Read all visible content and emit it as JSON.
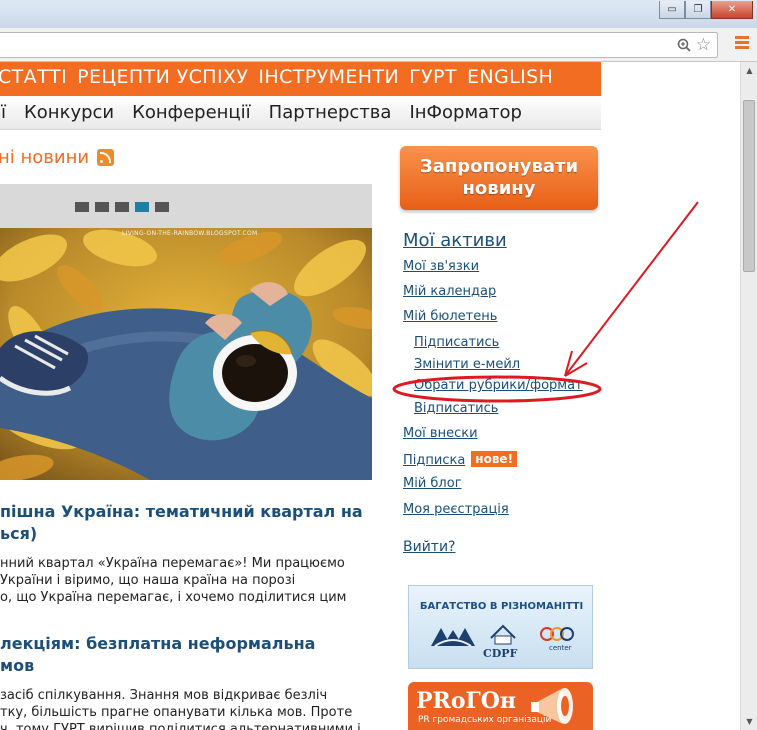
{
  "window": {
    "buttons": [
      "▭",
      "❐",
      "✕"
    ]
  },
  "nav_primary": [
    "СТАТТІ",
    "РЕЦЕПТИ УСПІХУ",
    "ІНСТРУМЕНТИ",
    "ГУРТ",
    "ENGLISH"
  ],
  "nav_secondary": [
    "ії",
    "Конкурси",
    "Конференції",
    "Партнерства",
    "ІнФорматор"
  ],
  "news": {
    "title": "ні новини"
  },
  "slider": {
    "total": 5,
    "active_index": 4
  },
  "photo": {
    "watermark": "LIVING-ON-THE-RAINBOW.BLOGSPOT.COM"
  },
  "articles": [
    {
      "title_lines": [
        "пішна Україна: тематичний квартал на",
        "ься)"
      ],
      "text_lines": [
        "нний квартал «Україна перемагає»! Ми працюємо",
        "України і віримо, що наша країна на порозі",
        "о, що Україна перемагає, і хочемо поділитися цим"
      ]
    },
    {
      "title_lines": [
        "лекціям: безплатна неформальна",
        "мов"
      ],
      "text_lines": [
        "засіб спілкування. Знання мов відкриває безліч",
        "тку, більшість прагне опанувати кілька мов. Проте",
        "ч, тому ГУРТ вирішив поділитися альтернативними і"
      ]
    }
  ],
  "sidebar": {
    "suggest_button": "Запропонувати новину",
    "assets_heading": "Мої активи",
    "links": {
      "connections": "Мої зв'язки",
      "calendar": "Мій календар",
      "bulletin": "Мій бюлетень",
      "subscribe": "Підписатись",
      "change_email": "Змінити е-мейл",
      "choose_rubrics": "Обрати рубрики/формат",
      "unsubscribe": "Відписатись",
      "contributions": "Мої внески",
      "subscription": "Підписка",
      "blog": "Мій блог",
      "registration": "Моя реєстрація"
    },
    "new_badge": "нове!",
    "logout": "Вийти?"
  },
  "banners": {
    "diversity": {
      "header": "БАГАТСТВО В РІЗНОМАНІТТІ",
      "logo2": "CDPF",
      "logo3": "center"
    },
    "progon": {
      "title": "PRоГОн",
      "subtitle": "PR громадських організацій"
    }
  },
  "colors": {
    "brand_orange": "#f26c22",
    "link_blue": "#1b4f7a",
    "annotation_red": "#dd1a22"
  }
}
